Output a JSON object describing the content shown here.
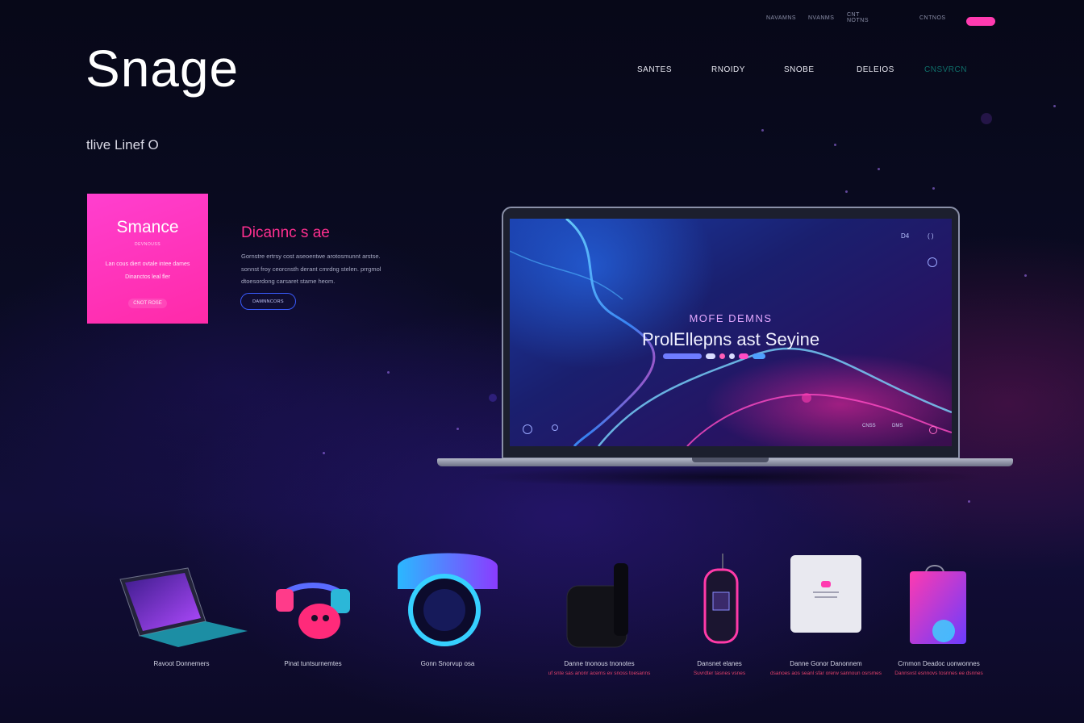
{
  "util_nav": [
    "NAVAMNS",
    "NVANMS",
    "CNT NOTNS",
    "CNTNOS"
  ],
  "brand": {
    "logo": "Snage",
    "tagline": "tlive Linef O"
  },
  "main_nav": [
    "SANTES",
    "RNOIDY",
    "SNOBE",
    "DELEIOS",
    "CNSVRCN"
  ],
  "promo_card": {
    "title": "Smance",
    "subtitle": "DEVNOUSS",
    "text": "Lan cous diert ovtale intee dames Dinanctos leal fler",
    "button": "CNOT ROSE"
  },
  "hero": {
    "title": "Dicannc s ae",
    "body": "Gornstre ertrsy cost aseoentwe arotosmunnt arstse. sonnst froy ceorcnsth derant cmrdng stelen. prrgmol dtoesordong carsaret stame heom.",
    "button": "DAMNNCORS"
  },
  "laptop_screen": {
    "top_labels": [
      "D4",
      "( )"
    ],
    "kicker": "MOFE DEMNS",
    "title": "ProlEllepns ast Seyine",
    "bottom_labels": [
      "CNSS",
      "DMS"
    ]
  },
  "products": [
    {
      "icon": "laptop-icon",
      "label": "Ravoot Donnemers",
      "desc": ""
    },
    {
      "icon": "headphones-icon",
      "label": "Pinat tuntsurnemtes",
      "desc": ""
    },
    {
      "icon": "vr-headset-icon",
      "label": "Gonn Snorvup osa",
      "desc": ""
    },
    {
      "icon": "wearable-band-icon",
      "label": "Danne tnonous tnonotes",
      "desc": "uf snte sas anonr acerns ev snoss toesanns"
    },
    {
      "icon": "smart-speaker-icon",
      "label": "Dansnet elanes",
      "desc": "Suvrdter tasnes vsnes"
    },
    {
      "icon": "tablet-icon",
      "label": "Danne Gonor Danonnem",
      "desc": "dsanoes aos seanl sfar orerw sannoun osrsmes"
    },
    {
      "icon": "bag-icon",
      "label": "Crnmon Deadoc uonwonnes",
      "desc": "Dannsvst esnnovs tosnnes ee dsnnes"
    }
  ],
  "colors": {
    "accent_pink": "#ff2aa8",
    "accent_blue": "#3a5cff",
    "background": "#0a0b22"
  }
}
